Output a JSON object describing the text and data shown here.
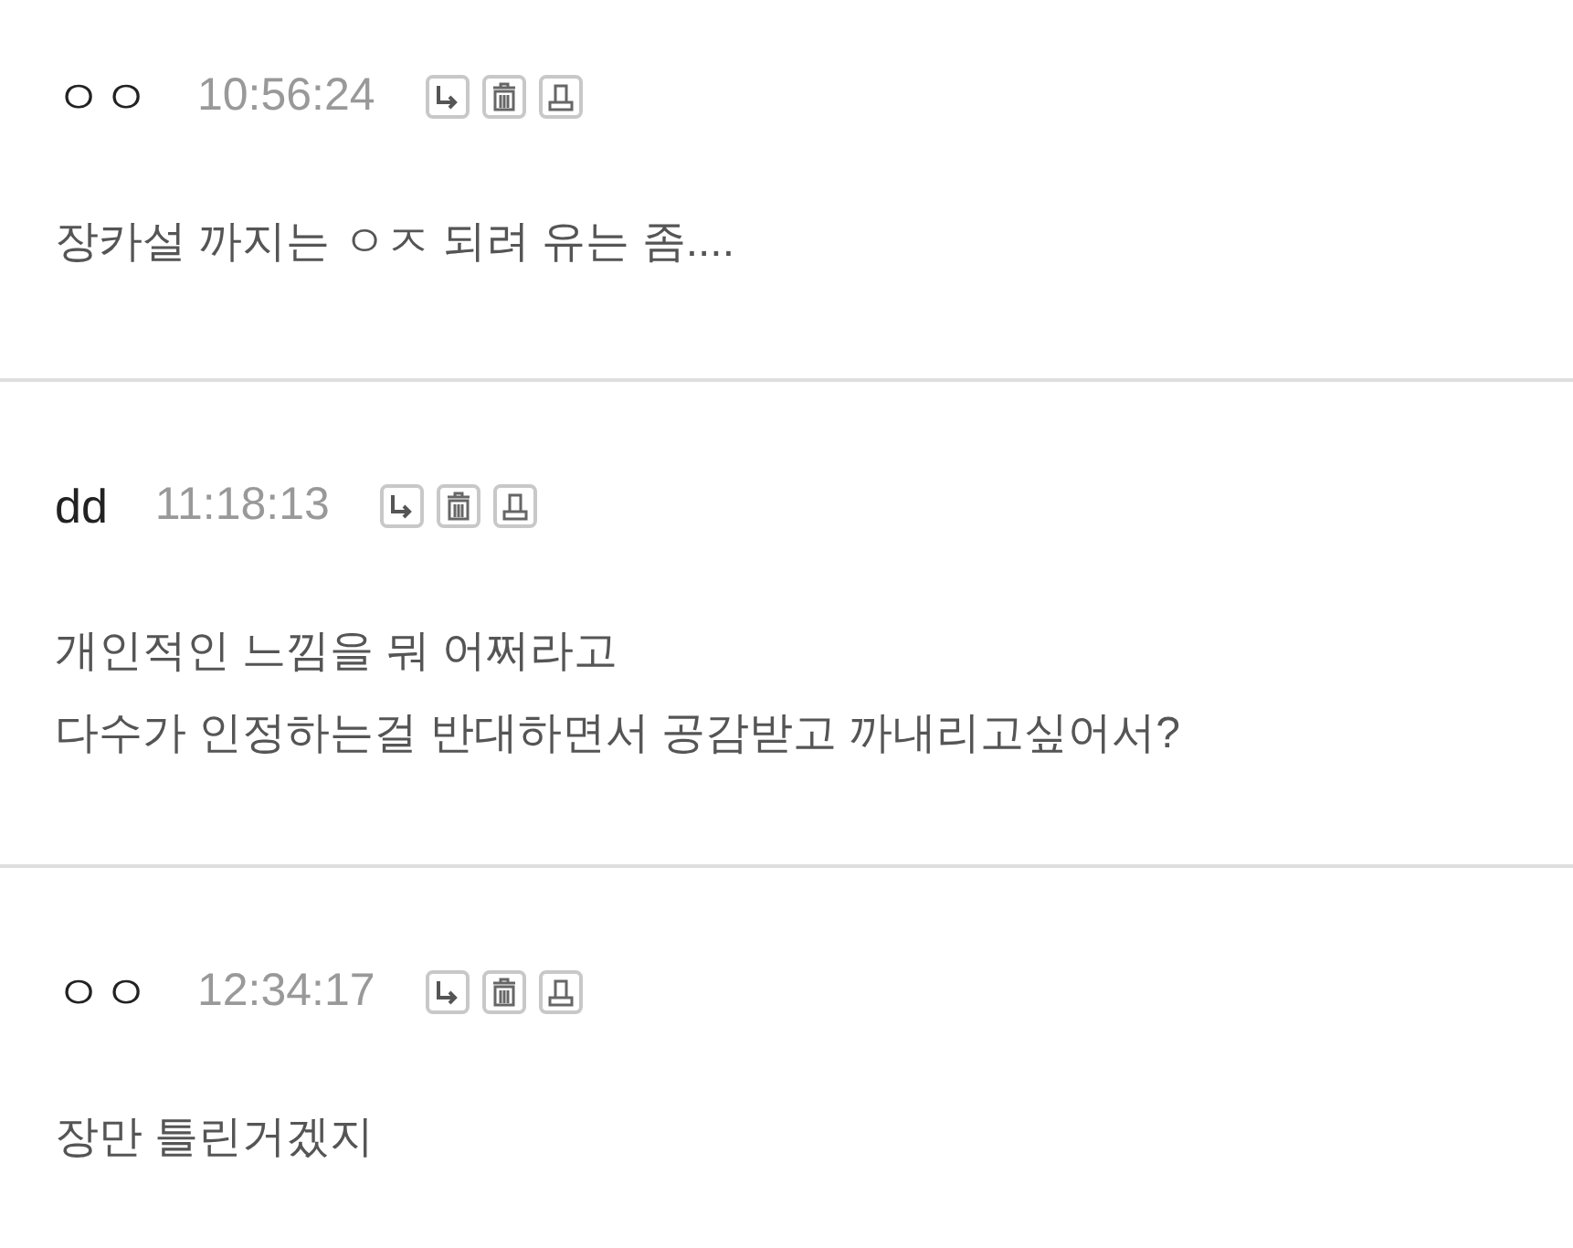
{
  "comments": [
    {
      "author": "ㅇㅇ",
      "time": "10:56:24",
      "lines": [
        "장카설 까지는 ㅇㅈ 되려 유는 좀...."
      ]
    },
    {
      "author": "dd",
      "time": "11:18:13",
      "lines": [
        "개인적인 느낌을 뭐 어쩌라고",
        "다수가 인정하는걸 반대하면서 공감받고 까내리고싶어서?"
      ]
    },
    {
      "author": "ㅇㅇ",
      "time": "12:34:17",
      "lines": [
        "장만 틀린거겠지"
      ]
    }
  ]
}
